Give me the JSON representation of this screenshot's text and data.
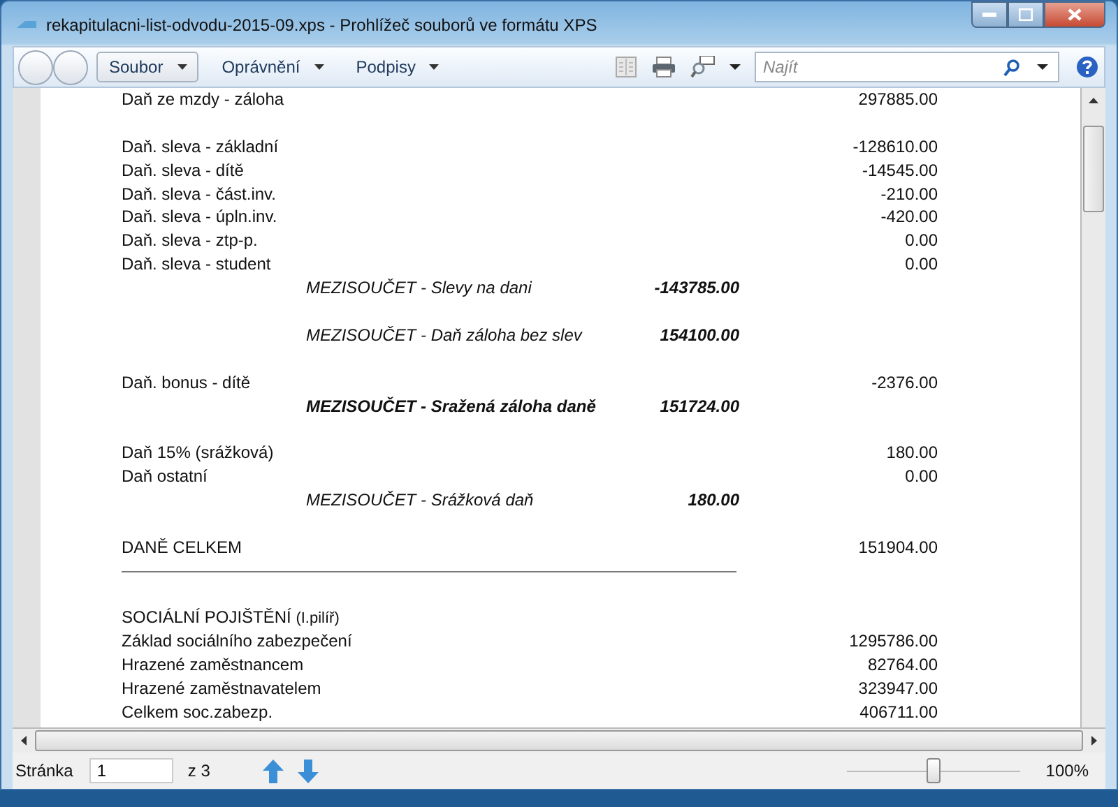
{
  "window": {
    "title": "rekapitulacni-list-odvodu-2015-09.xps - Prohlížeč souborů ve formátu XPS"
  },
  "toolbar": {
    "menus": [
      {
        "label": "Soubor",
        "boxed": true
      },
      {
        "label": "Oprávnění",
        "boxed": false
      },
      {
        "label": "Podpisy",
        "boxed": false
      }
    ],
    "search": {
      "placeholder": "Najít"
    }
  },
  "document": {
    "rows": [
      {
        "kind": "line",
        "label": "Daň ze mzdy - záloha",
        "value": "297885.00"
      },
      {
        "kind": "blank"
      },
      {
        "kind": "line",
        "label": "Daň. sleva - základní",
        "value": "-128610.00"
      },
      {
        "kind": "line",
        "label": "Daň. sleva - dítě",
        "value": "-14545.00"
      },
      {
        "kind": "line",
        "label": "Daň. sleva - část.inv.",
        "value": "-210.00"
      },
      {
        "kind": "line",
        "label": "Daň. sleva - úpln.inv.",
        "value": "-420.00"
      },
      {
        "kind": "line",
        "label": "Daň. sleva - ztp-p.",
        "value": "0.00"
      },
      {
        "kind": "line",
        "label": "Daň. sleva - student",
        "value": "0.00"
      },
      {
        "kind": "subtotal",
        "label": "MEZISOUČET - Slevy na dani",
        "value": "-143785.00",
        "bold": false
      },
      {
        "kind": "blank"
      },
      {
        "kind": "subtotal",
        "label": "MEZISOUČET - Daň záloha bez slev",
        "value": "154100.00",
        "bold": false
      },
      {
        "kind": "blank"
      },
      {
        "kind": "line",
        "label": "Daň. bonus - dítě",
        "value": "-2376.00"
      },
      {
        "kind": "subtotal",
        "label": "MEZISOUČET - Sražená záloha daně",
        "value": "151724.00",
        "bold": true
      },
      {
        "kind": "blank"
      },
      {
        "kind": "line",
        "label": "Daň 15% (srážková)",
        "value": "180.00"
      },
      {
        "kind": "line",
        "label": "Daň ostatní",
        "value": "0.00"
      },
      {
        "kind": "subtotal",
        "label": "MEZISOUČET - Srážková daň",
        "value": "180.00",
        "bold": false
      },
      {
        "kind": "blank"
      },
      {
        "kind": "line",
        "label": "DANĚ CELKEM",
        "value": "151904.00"
      },
      {
        "kind": "rule"
      },
      {
        "kind": "blank"
      },
      {
        "kind": "heading",
        "label": "SOCIÁLNÍ POJIŠTĚNÍ",
        "note": "(I.pilíř)"
      },
      {
        "kind": "line",
        "label": "Základ sociálního zabezpečení",
        "value": "1295786.00"
      },
      {
        "kind": "line",
        "label": "Hrazené  zaměstnancem",
        "value": "82764.00"
      },
      {
        "kind": "line",
        "label": "Hrazené  zaměstnavatelem",
        "value": "323947.00"
      },
      {
        "kind": "line",
        "label": "Celkem soc.zabezp.",
        "value": "406711.00"
      }
    ]
  },
  "status_bar": {
    "page_label": "Stránka",
    "page": "1",
    "page_count": "z 3",
    "zoom": {
      "level": 0.5,
      "reading": "100%"
    }
  }
}
